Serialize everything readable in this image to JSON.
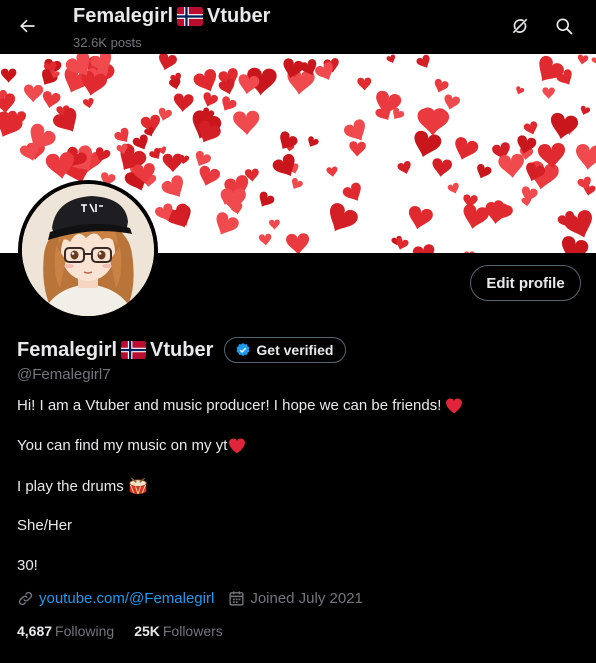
{
  "header": {
    "display_name_start": "Femalegirl",
    "display_name_end": "Vtuber",
    "post_count": "32.6K posts"
  },
  "profile": {
    "display_name_start": "Femalegirl",
    "display_name_end": "Vtuber",
    "handle": "@Femalegirl7",
    "edit_label": "Edit profile",
    "verify_label": "Get verified"
  },
  "bio": {
    "line1": "Hi! I am a Vtuber and music producer! I hope we can be friends!",
    "line2": "You can find my music on my yt",
    "line3": "I play the drums",
    "line4": "She/Her",
    "line5": "30!"
  },
  "meta": {
    "website": "youtube.com/@Femalegirl",
    "joined": "Joined July 2021"
  },
  "stats": {
    "following_count": "4,687",
    "following_label": "Following",
    "followers_count": "25K",
    "followers_label": "Followers"
  },
  "colors": {
    "background": "#000000",
    "text_primary": "#e7e9ea",
    "text_secondary": "#71767b",
    "link": "#1d9bf0",
    "verified_badge": "#1d9bf0",
    "heart": "#f91880",
    "banner_hearts": "#e0202a"
  },
  "icons": [
    "back-arrow-icon",
    "norway-flag-icon",
    "hide-media-icon",
    "search-icon",
    "verified-badge-icon",
    "red-heart-icon",
    "drum-icon",
    "link-icon",
    "calendar-icon"
  ]
}
